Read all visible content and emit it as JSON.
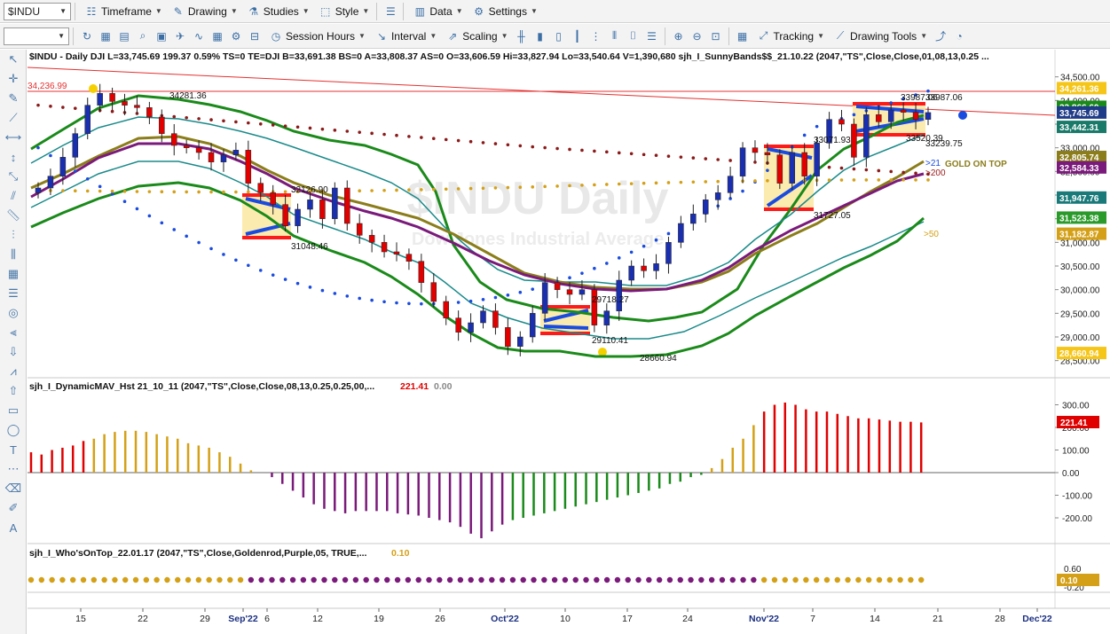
{
  "toolbar1": {
    "symbol": "$INDU",
    "timeframe": "Timeframe",
    "drawing": "Drawing",
    "studies": "Studies",
    "style": "Style",
    "data": "Data",
    "settings": "Settings"
  },
  "toolbar2": {
    "session_hours": "Session Hours",
    "interval": "Interval",
    "scaling": "Scaling",
    "tracking": "Tracking",
    "drawing_tools": "Drawing Tools"
  },
  "price_panel": {
    "header": "$INDU - Daily  DJI  L=33,745.69  199.37  0.59%  TS=0  TE=DJI  B=33,691.38  BS=0  A=33,808.37  AS=0  O=33,606.59  Hi=33,827.94  Lo=33,540.64  V=1,390,680  sjh_I_SunnyBands$$_21.10.22 (2047,\"TS\",Close,Close,01,08,13,0.25 ...",
    "watermark_title": "$INDU Daily",
    "watermark_subtitle": "Dow Jones Industrial Average",
    "trend_label": "34,236.99",
    "annotations": {
      "a1": "34281.36",
      "a2": "32126.90",
      "a3": "31048.46",
      "a4": "29718.27",
      "a5": "29110.41",
      "a6": "28660.94",
      "a7": "33071.93",
      "a8": "31727.05",
      "a9": "33987.06",
      "a10": "33987.06",
      "a11": "33520.39",
      "a12": "33239.75",
      "ma21": ">21",
      "ma200": ">200",
      "ma50": ">50",
      "gold": "GOLD ON TOP"
    },
    "axis_ticks": [
      "34,500.00",
      "34,000.00",
      "33,500.00",
      "33,000.00",
      "32,500.00",
      "32,000.00",
      "31,500.00",
      "31,000.00",
      "30,500.00",
      "30,000.00",
      "29,500.00",
      "29,000.00",
      "28,500.00"
    ],
    "price_tags": [
      {
        "text": "34,261.36",
        "color": "#f5c518",
        "fg": "#ffffff",
        "price": 34261.36
      },
      {
        "text": "33,866.60",
        "color": "#1a8a1a",
        "fg": "#ffffff",
        "price": 33866.6
      },
      {
        "text": "33,745.69",
        "color": "#1f3c88",
        "fg": "#ffffff",
        "price": 33745.69
      },
      {
        "text": "33,442.31",
        "color": "#1a7a6a",
        "fg": "#ffffff",
        "price": 33442.31
      },
      {
        "text": "32,805.74",
        "color": "#8b7d1a",
        "fg": "#ffffff",
        "price": 32805.74
      },
      {
        "text": "32,584.33",
        "color": "#7a1a7a",
        "fg": "#ffffff",
        "price": 32584.33
      },
      {
        "text": "31,947.76",
        "color": "#1a7a7a",
        "fg": "#ffffff",
        "price": 31947.76
      },
      {
        "text": "31,523.38",
        "color": "#2a9a2a",
        "fg": "#ffffff",
        "price": 31523.38
      },
      {
        "text": "31,182.87",
        "color": "#d4a017",
        "fg": "#ffffff",
        "price": 31182.87
      },
      {
        "text": "28,660.94",
        "color": "#f5c518",
        "fg": "#ffffff",
        "price": 28660.94
      }
    ]
  },
  "histogram_panel": {
    "header": "sjh_I_DynamicMAV_Hst 21_10_11 (2047,\"TS\",Close,Close,08,13,0.25,0.25,00,...",
    "value1": "221.41",
    "value2": "0.00",
    "axis_ticks": [
      "300.00",
      "200.00",
      "100.00",
      "0.00",
      "-100.00",
      "-200.00"
    ],
    "tag": "221.41"
  },
  "who_panel": {
    "header": "sjh_I_Who'sOnTop_22.01.17 (2047,\"TS\",Close,Goldenrod,Purple,05, TRUE,...",
    "value": "0.10",
    "axis_ticks": [
      "0.60",
      "0.10",
      "-0.20"
    ],
    "tag": "0.10"
  },
  "time_axis": [
    "15",
    "22",
    "29",
    "Sep'22",
    "6",
    "12",
    "19",
    "26",
    "Oct'22",
    "10",
    "17",
    "24",
    "Nov'22",
    "7",
    "14",
    "21",
    "28",
    "Dec'22"
  ],
  "chart_data": {
    "type": "candlestick",
    "period": "Daily",
    "symbol": "$INDU",
    "ylim": [
      28400,
      34700
    ],
    "candles_approx_close": [
      32150,
      32400,
      32800,
      33300,
      33900,
      34150,
      33980,
      33900,
      33850,
      33650,
      33300,
      33050,
      33000,
      32900,
      32700,
      32850,
      32950,
      32250,
      32050,
      31800,
      31350,
      31700,
      31900,
      31500,
      32150,
      31400,
      31150,
      31000,
      30800,
      30750,
      30600,
      30150,
      29750,
      29400,
      29100,
      29300,
      29550,
      29200,
      28800,
      29000,
      29500,
      30150,
      30000,
      29900,
      30000,
      29250,
      29550,
      30200,
      30500,
      30400,
      30550,
      31000,
      31400,
      31600,
      31900,
      32050,
      32400,
      33000,
      32900,
      32850,
      32250,
      32900,
      32400,
      33100,
      33600,
      33500,
      32800,
      33700,
      33550,
      33800,
      33750,
      33600,
      33745
    ]
  }
}
